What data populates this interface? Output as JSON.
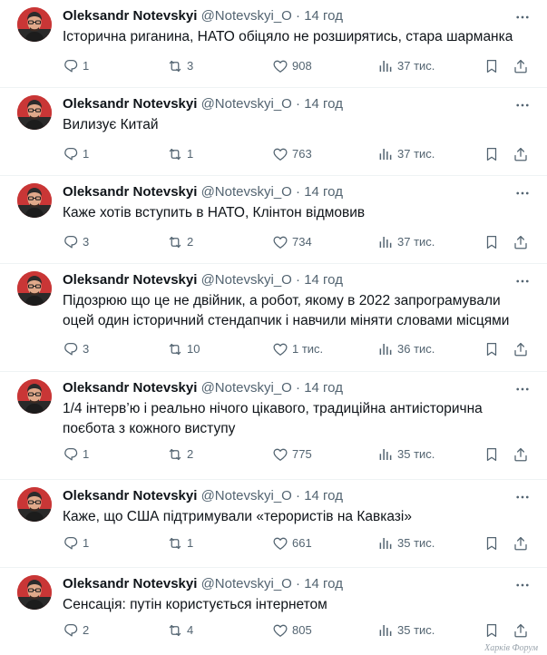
{
  "author": {
    "name": "Oleksandr Notevskyi",
    "handle": "@Notevskyi_O",
    "separator": "·",
    "time": "14 год"
  },
  "tweets": [
    {
      "text": "Історична риганина, НАТО обіцяло не розширятись, стара шарманка",
      "replies": "1",
      "retweets": "3",
      "likes": "908",
      "views": "37 тис."
    },
    {
      "text": "Вилизує Китай",
      "replies": "1",
      "retweets": "1",
      "likes": "763",
      "views": "37 тис."
    },
    {
      "text": "Каже хотів вступить в НАТО, Клінтон відмовив",
      "replies": "3",
      "retweets": "2",
      "likes": "734",
      "views": "37 тис."
    },
    {
      "text": "Підозрюю що це не двійник, а робот, якому в 2022 запрограмували оцей один історичний стендапчик і навчили міняти словами місцями",
      "replies": "3",
      "retweets": "10",
      "likes": "1 тис.",
      "views": "36 тис."
    },
    {
      "text": "1/4 інтерв’ю і реально нічого цікавого, традиційна антиісторична поєбота з кожного виступу",
      "replies": "1",
      "retweets": "2",
      "likes": "775",
      "views": "35 тис."
    },
    {
      "text": "Каже, що США підтримували «терористів на Кавказі»",
      "replies": "1",
      "retweets": "1",
      "likes": "661",
      "views": "35 тис."
    },
    {
      "text": "Сенсація: путін користується інтернетом",
      "replies": "2",
      "retweets": "4",
      "likes": "805",
      "views": "35 тис."
    }
  ],
  "watermark": "Харків Форум",
  "icons": [
    "more-icon",
    "reply-icon",
    "retweet-icon",
    "like-icon",
    "views-icon",
    "bookmark-icon",
    "share-icon"
  ]
}
